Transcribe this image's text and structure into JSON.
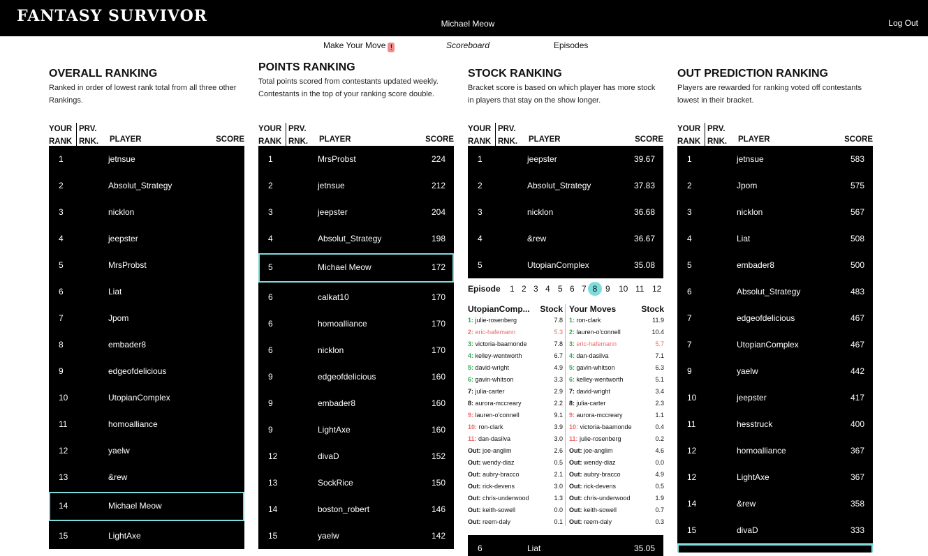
{
  "header": {
    "logo": "FANTASY SURVIVOR",
    "user": "Michael Meow",
    "logout": "Log Out"
  },
  "subnav": {
    "make_move": "Make Your Move",
    "alert": "!",
    "scoreboard": "Scoreboard",
    "episodes": "Episodes"
  },
  "table_headers": {
    "your": "YOUR",
    "rank": "RANK",
    "prv": "PRV.",
    "rnk": "RNK.",
    "player": "PLAYER",
    "score": "SCORE"
  },
  "overall": {
    "title": "OVERALL RANKING",
    "desc": "Ranked in order of lowest rank total from all three other Rankings.",
    "rows": [
      {
        "rank": "1",
        "name": "jetnsue",
        "score": ""
      },
      {
        "rank": "2",
        "name": "Absolut_Strategy",
        "score": ""
      },
      {
        "rank": "3",
        "name": "nicklon",
        "score": ""
      },
      {
        "rank": "4",
        "name": "jeepster",
        "score": ""
      },
      {
        "rank": "5",
        "name": "MrsProbst",
        "score": ""
      },
      {
        "rank": "6",
        "name": "Liat",
        "score": ""
      },
      {
        "rank": "7",
        "name": "Jpom",
        "score": ""
      },
      {
        "rank": "8",
        "name": "embader8",
        "score": ""
      },
      {
        "rank": "9",
        "name": "edgeofdelicious",
        "score": ""
      },
      {
        "rank": "10",
        "name": "UtopianComplex",
        "score": ""
      },
      {
        "rank": "11",
        "name": "homoalliance",
        "score": ""
      },
      {
        "rank": "12",
        "name": "yaelw",
        "score": ""
      },
      {
        "rank": "13",
        "name": "&rew",
        "score": ""
      },
      {
        "rank": "14",
        "name": "Michael Meow",
        "score": "",
        "hl": true
      },
      {
        "rank": "15",
        "name": "LightAxe",
        "score": ""
      }
    ]
  },
  "points": {
    "title": "POINTS RANKING",
    "desc": "Total points scored from contestants updated weekly. Contestants in the top of your ranking score double.",
    "rows": [
      {
        "rank": "1",
        "name": "MrsProbst",
        "score": "224"
      },
      {
        "rank": "2",
        "name": "jetnsue",
        "score": "212"
      },
      {
        "rank": "3",
        "name": "jeepster",
        "score": "204"
      },
      {
        "rank": "4",
        "name": "Absolut_Strategy",
        "score": "198"
      },
      {
        "rank": "5",
        "name": "Michael Meow",
        "score": "172",
        "hl": true
      },
      {
        "rank": "6",
        "name": "calkat10",
        "score": "170"
      },
      {
        "rank": "6",
        "name": "homoalliance",
        "score": "170"
      },
      {
        "rank": "6",
        "name": "nicklon",
        "score": "170"
      },
      {
        "rank": "9",
        "name": "edgeofdelicious",
        "score": "160"
      },
      {
        "rank": "9",
        "name": "embader8",
        "score": "160"
      },
      {
        "rank": "9",
        "name": "LightAxe",
        "score": "160"
      },
      {
        "rank": "12",
        "name": "divaD",
        "score": "152"
      },
      {
        "rank": "13",
        "name": "SockRice",
        "score": "150"
      },
      {
        "rank": "14",
        "name": "boston_robert",
        "score": "146"
      },
      {
        "rank": "15",
        "name": "yaelw",
        "score": "142"
      }
    ]
  },
  "stock": {
    "title": "STOCK RANKING",
    "desc": "Bracket score is based on which player has more stock in players that stay on the show longer.",
    "rows": [
      {
        "rank": "1",
        "name": "jeepster",
        "score": "39.67"
      },
      {
        "rank": "2",
        "name": "Absolut_Strategy",
        "score": "37.83"
      },
      {
        "rank": "3",
        "name": "nicklon",
        "score": "36.68"
      },
      {
        "rank": "4",
        "name": "&rew",
        "score": "36.67"
      },
      {
        "rank": "5",
        "name": "UtopianComplex",
        "score": "35.08"
      }
    ],
    "bottom_row": {
      "rank": "6",
      "name": "Liat",
      "score": "35.05"
    },
    "episode_label": "Episode",
    "episodes": [
      "1",
      "2",
      "3",
      "4",
      "5",
      "6",
      "7",
      "8",
      "9",
      "10",
      "11",
      "12"
    ],
    "active_episode": "8",
    "left_title": "UtopianComp...",
    "right_title": "Your Moves",
    "stock_label": "Stock",
    "left_moves": [
      {
        "pos": "1:",
        "name": "julie-rosenberg",
        "stock": "7.8",
        "pc": "green"
      },
      {
        "pos": "2:",
        "name": "eric-hafemann",
        "stock": "5.3",
        "pc": "red",
        "red": true
      },
      {
        "pos": "3:",
        "name": "victoria-baamonde",
        "stock": "7.8",
        "pc": "green"
      },
      {
        "pos": "4:",
        "name": "kelley-wentworth",
        "stock": "6.7",
        "pc": "green"
      },
      {
        "pos": "5:",
        "name": "david-wright",
        "stock": "4.9",
        "pc": "green"
      },
      {
        "pos": "6:",
        "name": "gavin-whitson",
        "stock": "3.3",
        "pc": "green"
      },
      {
        "pos": "7:",
        "name": "julia-carter",
        "stock": "2.9",
        "pc": ""
      },
      {
        "pos": "8:",
        "name": "aurora-mccreary",
        "stock": "2.2",
        "pc": ""
      },
      {
        "pos": "9:",
        "name": "lauren-o'connell",
        "stock": "9.1",
        "pc": "red"
      },
      {
        "pos": "10:",
        "name": "ron-clark",
        "stock": "3.9",
        "pc": "red"
      },
      {
        "pos": "11:",
        "name": "dan-dasilva",
        "stock": "3.0",
        "pc": "red"
      },
      {
        "pos": "Out:",
        "name": "joe-anglim",
        "stock": "2.6",
        "pc": ""
      },
      {
        "pos": "Out:",
        "name": "wendy-diaz",
        "stock": "0.5",
        "pc": ""
      },
      {
        "pos": "Out:",
        "name": "aubry-bracco",
        "stock": "2.1",
        "pc": ""
      },
      {
        "pos": "Out:",
        "name": "rick-devens",
        "stock": "3.0",
        "pc": ""
      },
      {
        "pos": "Out:",
        "name": "chris-underwood",
        "stock": "1.3",
        "pc": ""
      },
      {
        "pos": "Out:",
        "name": "keith-sowell",
        "stock": "0.0",
        "pc": ""
      },
      {
        "pos": "Out:",
        "name": "reem-daly",
        "stock": "0.1",
        "pc": ""
      }
    ],
    "right_moves": [
      {
        "pos": "1:",
        "name": "ron-clark",
        "stock": "11.9",
        "pc": "green"
      },
      {
        "pos": "2:",
        "name": "lauren-o'connell",
        "stock": "10.4",
        "pc": "green"
      },
      {
        "pos": "3:",
        "name": "eric-hafemann",
        "stock": "5.7",
        "pc": "green",
        "red": true
      },
      {
        "pos": "4:",
        "name": "dan-dasilva",
        "stock": "7.1",
        "pc": "green"
      },
      {
        "pos": "5:",
        "name": "gavin-whitson",
        "stock": "6.3",
        "pc": "green"
      },
      {
        "pos": "6:",
        "name": "kelley-wentworth",
        "stock": "5.1",
        "pc": "green"
      },
      {
        "pos": "7:",
        "name": "david-wright",
        "stock": "3.4",
        "pc": ""
      },
      {
        "pos": "8:",
        "name": "julia-carter",
        "stock": "2.3",
        "pc": ""
      },
      {
        "pos": "9:",
        "name": "aurora-mccreary",
        "stock": "1.1",
        "pc": "red"
      },
      {
        "pos": "10:",
        "name": "victoria-baamonde",
        "stock": "0.4",
        "pc": "red"
      },
      {
        "pos": "11:",
        "name": "julie-rosenberg",
        "stock": "0.2",
        "pc": "red"
      },
      {
        "pos": "Out:",
        "name": "joe-anglim",
        "stock": "4.6",
        "pc": ""
      },
      {
        "pos": "Out:",
        "name": "wendy-diaz",
        "stock": "0.0",
        "pc": ""
      },
      {
        "pos": "Out:",
        "name": "aubry-bracco",
        "stock": "4.9",
        "pc": ""
      },
      {
        "pos": "Out:",
        "name": "rick-devens",
        "stock": "0.5",
        "pc": ""
      },
      {
        "pos": "Out:",
        "name": "chris-underwood",
        "stock": "1.9",
        "pc": ""
      },
      {
        "pos": "Out:",
        "name": "keith-sowell",
        "stock": "0.7",
        "pc": ""
      },
      {
        "pos": "Out:",
        "name": "reem-daly",
        "stock": "0.3",
        "pc": ""
      }
    ]
  },
  "out": {
    "title": "OUT PREDICTION RANKING",
    "desc": "Players are rewarded for ranking voted off contestants lowest in their bracket.",
    "rows": [
      {
        "rank": "1",
        "name": "jetnsue",
        "score": "583"
      },
      {
        "rank": "2",
        "name": "Jpom",
        "score": "575"
      },
      {
        "rank": "3",
        "name": "nicklon",
        "score": "567"
      },
      {
        "rank": "4",
        "name": "Liat",
        "score": "508"
      },
      {
        "rank": "5",
        "name": "embader8",
        "score": "500"
      },
      {
        "rank": "6",
        "name": "Absolut_Strategy",
        "score": "483"
      },
      {
        "rank": "7",
        "name": "edgeofdelicious",
        "score": "467"
      },
      {
        "rank": "7",
        "name": "UtopianComplex",
        "score": "467"
      },
      {
        "rank": "9",
        "name": "yaelw",
        "score": "442"
      },
      {
        "rank": "10",
        "name": "jeepster",
        "score": "417"
      },
      {
        "rank": "11",
        "name": "hesstruck",
        "score": "400"
      },
      {
        "rank": "12",
        "name": "homoalliance",
        "score": "367"
      },
      {
        "rank": "12",
        "name": "LightAxe",
        "score": "367"
      },
      {
        "rank": "14",
        "name": "&rew",
        "score": "358"
      },
      {
        "rank": "15",
        "name": "divaD",
        "score": "333"
      }
    ]
  }
}
